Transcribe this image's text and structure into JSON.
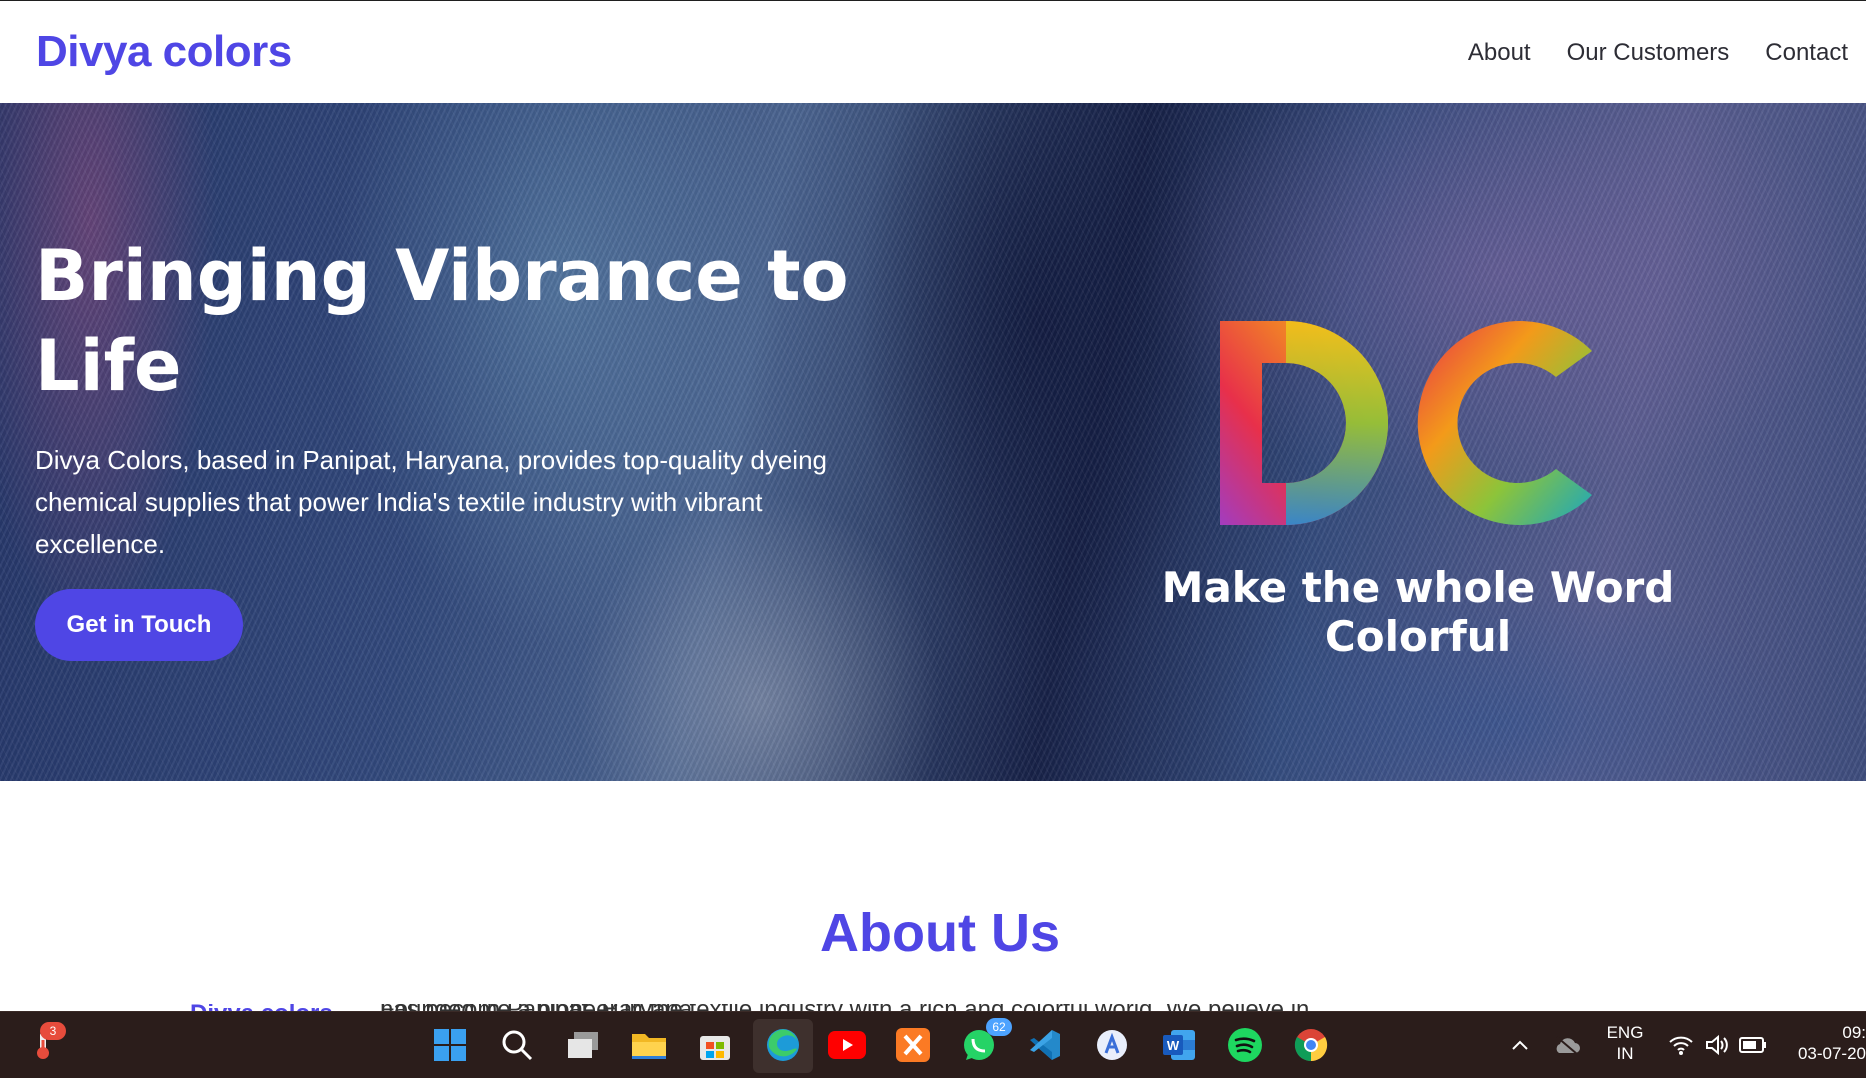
{
  "brand": "Divya colors",
  "nav": {
    "about": "About",
    "customers": "Our Customers",
    "contact": "Contact"
  },
  "hero": {
    "title_line1": "Bringing Vibrance to",
    "title_line2": "Life",
    "description": "Divya Colors, based in Panipat, Haryana, provides top-quality dyeing chemical supplies that power India's textile industry with vibrant excellence.",
    "cta": "Get in Touch",
    "logo_text": "DC",
    "tagline": "Make the whole Word Colorful"
  },
  "about": {
    "title": "About Us",
    "partial_text_start": "Founded in Panipat, Haryana,",
    "partial_text_brand": "Divya colors",
    "partial_text_end": "has become a pioneer in the textile industry with a rich and colorful world. We believe in"
  },
  "taskbar": {
    "weather_badge": "3",
    "whatsapp_badge": "62",
    "language_line1": "ENG",
    "language_line2": "IN",
    "time": "09:",
    "date": "03-07-20"
  },
  "colors": {
    "accent": "#4f46e5",
    "taskbar": "#2b1d1b"
  },
  "icons": [
    "weather-icon",
    "start-icon",
    "search-icon",
    "task-view-icon",
    "file-explorer-icon",
    "store-icon",
    "edge-icon",
    "youtube-icon",
    "xampp-icon",
    "whatsapp-icon",
    "vscode-icon",
    "app-icon",
    "word-icon",
    "spotify-icon",
    "chrome-icon",
    "chevron-up-icon",
    "cloud-icon",
    "wifi-icon",
    "volume-icon",
    "battery-icon"
  ]
}
